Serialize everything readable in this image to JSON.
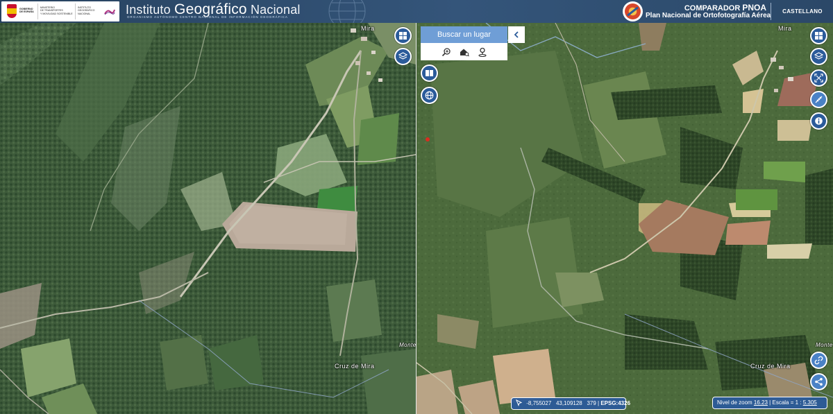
{
  "header": {
    "gov_logo": {
      "line1": "GOBIERNO",
      "line2": "DE ESPAÑA",
      "ministry_lines": [
        "MINISTERIO",
        "DE TRANSPORTES",
        "Y MOVILIDAD SOSTENIBLE"
      ],
      "agency_lines": [
        "INSTITUTO",
        "GEOGRÁFICO",
        "NACIONAL"
      ],
      "mark": "ign"
    },
    "title_pre": "Instituto ",
    "title_mid": "Geográfico",
    "title_post": " Nacional",
    "subtitle": "ORGANISMO AUTÓNOMO   CENTRO NACIONAL DE INFORMACIÓN GEOGRÁFICA",
    "app_title_pre": "COMPARADOR ",
    "app_title_bold": "PNOA",
    "app_subtitle": "Plan Nacional de Ortofotografía Aérea",
    "language": "CASTELLANO"
  },
  "map_left": {
    "labels": {
      "mira": "Mira",
      "cruz": "Cruz de Mira",
      "monte": "Monte"
    },
    "buttons": [
      "layout-icon",
      "layers-icon"
    ]
  },
  "map_right": {
    "labels": {
      "mira": "Mira",
      "cruz": "Cruz de Mira",
      "monte": "Monte"
    },
    "buttons": [
      "layout-icon",
      "layers-icon",
      "zoom-extent-icon",
      "ruler-icon",
      "info-icon",
      "link-icon",
      "share-icon"
    ]
  },
  "search": {
    "label": "Buscar un lugar",
    "tools": [
      "search-zoom-icon",
      "search-home-icon",
      "search-location-icon"
    ]
  },
  "coordinates": {
    "lon": "-8,755027",
    "lat": "43,109128",
    "alt": "379",
    "sep": " | ",
    "crs": "EPSG:4326"
  },
  "zoom": {
    "label": "Nivel de zoom",
    "value": "16.23",
    "scale_label": " | Escala = 1 : ",
    "scale_value": "5.305"
  },
  "colors": {
    "header_bg": "#2f4f73",
    "button_blue": "#2b5b9a",
    "search_blue": "#6f9ed6"
  }
}
